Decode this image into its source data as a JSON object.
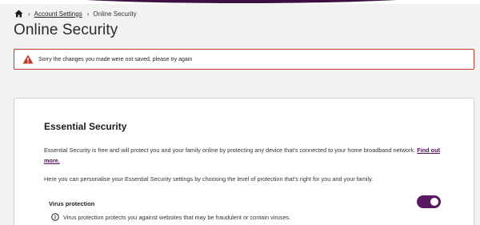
{
  "breadcrumb": {
    "home_icon": "home-icon",
    "separator_icon": "chevron-right-icon",
    "items": [
      {
        "label": "Account Settings"
      },
      {
        "label": "Online Security"
      }
    ]
  },
  "page": {
    "title": "Online Security"
  },
  "alert": {
    "icon": "warning-icon",
    "message": "Sorry the changes you made were not saved, please try again",
    "color": "#c0392b"
  },
  "card": {
    "title": "Essential Security",
    "description": "Essential Security is free and will protect you and your family online by protecting any device that's connected to your home broadband network.",
    "find_out_more": "Find out more.",
    "personalise_text": "Here you can personalise your Essential Security settings by choosing the level of protection that's right for you and your family.",
    "virus_protection": {
      "label": "Virus protection",
      "enabled": true,
      "info_icon": "info-icon",
      "info_text": "Virus protection protects you against websites that may be fraudulent or contain viruses."
    }
  },
  "colors": {
    "brand": "#5a1a63",
    "header_arc": "#3b0f3f",
    "link": "#4b1152"
  }
}
